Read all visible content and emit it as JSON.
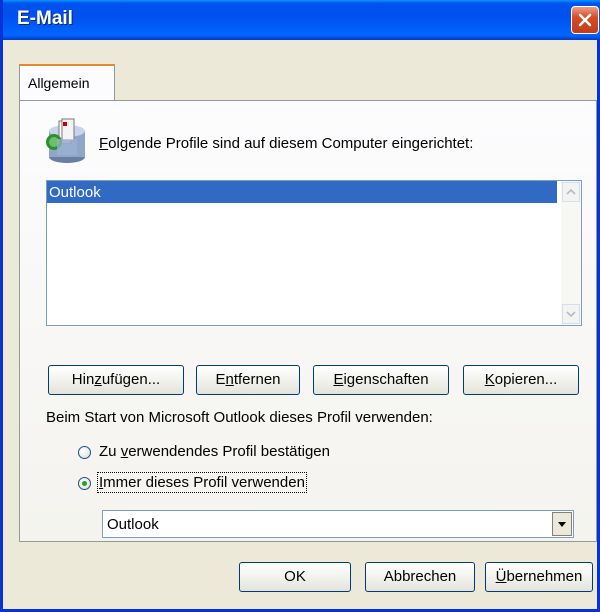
{
  "window": {
    "title": "E-Mail"
  },
  "tabs": [
    {
      "label": "Allgemein"
    }
  ],
  "profiles": {
    "label": "Folgende Profile sind auf diesem Computer eingerichtet:",
    "items": [
      "Outlook"
    ],
    "selected": "Outlook"
  },
  "actions": {
    "add": "Hinzufügen...",
    "remove": "Entfernen",
    "properties": "Eigenschaften",
    "copy": "Kopieren..."
  },
  "startup": {
    "label": "Beim Start von Microsoft Outlook dieses Profil verwenden:",
    "option_confirm": "Zu verwendendes Profil bestätigen",
    "option_always": "Immer dieses Profil verwenden",
    "selected_option": "always",
    "profile_value": "Outlook"
  },
  "footer": {
    "ok": "OK",
    "cancel": "Abbrechen",
    "apply": "Übernehmen"
  }
}
